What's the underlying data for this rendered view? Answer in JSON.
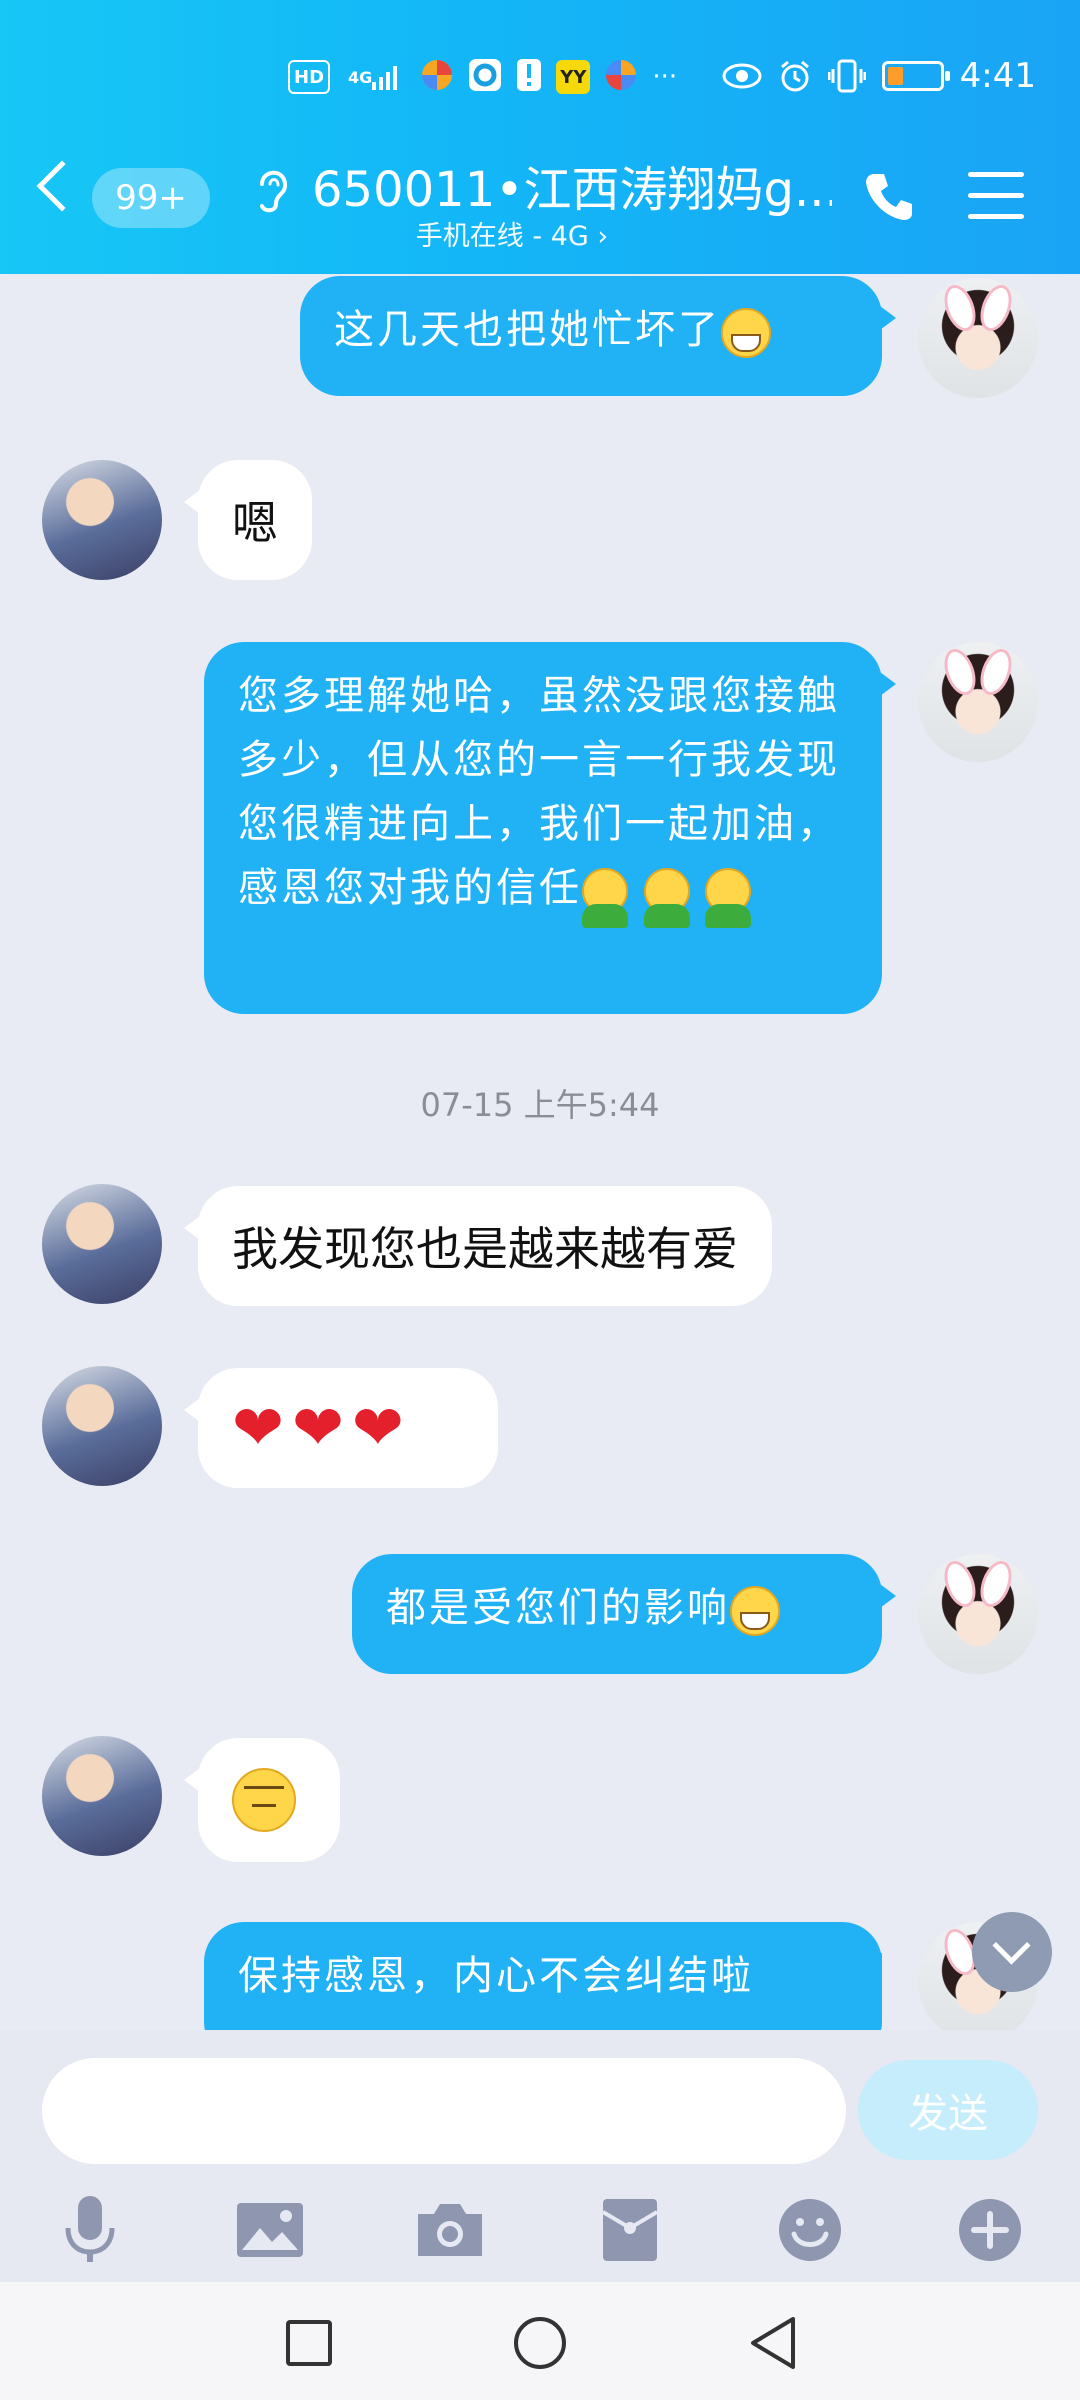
{
  "status_bar": {
    "time": "4:41",
    "left_badges": [
      "HD",
      "4G",
      "",
      "",
      "!",
      "YY",
      "",
      "···"
    ],
    "battery_level": 0.3
  },
  "header": {
    "unread_count": "99+",
    "title": "650011•江西涛翔妈g...",
    "subtitle": "手机在线 - 4G ›"
  },
  "messages": [
    {
      "side": "out",
      "text": "这几天也把她忙坏了",
      "emoji": "grin"
    },
    {
      "side": "in",
      "text": "嗯"
    },
    {
      "side": "out",
      "text": "您多理解她哈，虽然没跟您接触多少，但从您的一言一行我发现您很精进向上，我们一起加油，感恩您对我的信任",
      "emoji": "green x3"
    },
    {
      "side": "in",
      "text": "我发现您也是越来越有爱"
    },
    {
      "side": "in",
      "text": "",
      "emoji": "heart x3"
    },
    {
      "side": "out",
      "text": "都是受您们的影响",
      "emoji": "grin"
    },
    {
      "side": "in",
      "text": "",
      "emoji": "meh"
    },
    {
      "side": "out",
      "text": "保持感恩，内心不会纠结啦"
    }
  ],
  "timestamp": "07-15 上午5:44",
  "input": {
    "value": "",
    "send_label": "发送"
  },
  "toolbar": [
    "microphone-icon",
    "image-icon",
    "camera-icon",
    "red-packet-icon",
    "emoji-icon",
    "plus-icon"
  ],
  "nav": [
    "recent-apps-icon",
    "home-icon",
    "back-icon"
  ],
  "colors": {
    "header": "#13b6f7",
    "outgoing_bubble": "#20b2f5",
    "incoming_bubble": "#ffffff",
    "chat_background": "#e9ebf4"
  }
}
